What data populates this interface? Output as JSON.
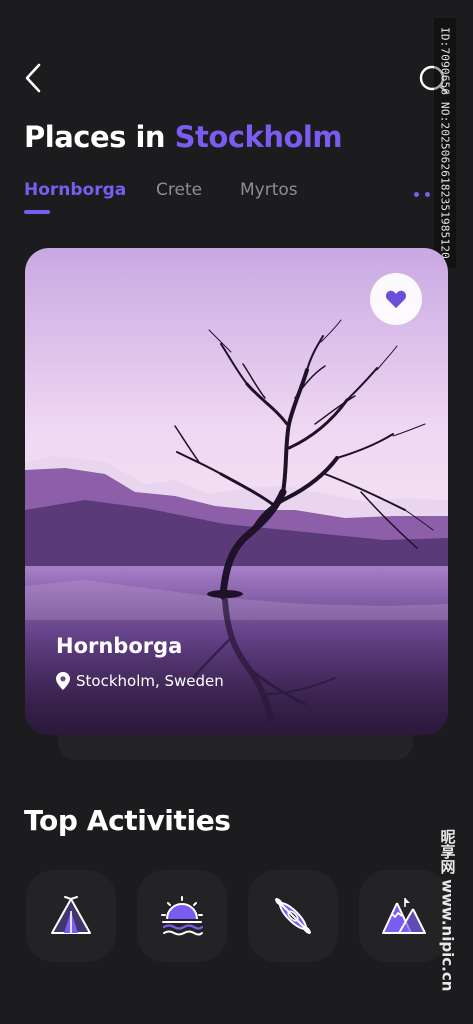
{
  "header": {
    "title_prefix": "Places in ",
    "title_city": "Stockholm"
  },
  "tabs": [
    {
      "label": "Hornborga",
      "active": true
    },
    {
      "label": "Crete",
      "active": false
    },
    {
      "label": "Myrtos",
      "active": false
    }
  ],
  "featured": {
    "name": "Hornborga",
    "location": "Stockholm, Sweden",
    "favorited": true
  },
  "activities": {
    "title": "Top Activities",
    "items": [
      {
        "icon": "tent-icon"
      },
      {
        "icon": "sunset-icon"
      },
      {
        "icon": "kayak-icon"
      },
      {
        "icon": "mountain-icon"
      }
    ]
  },
  "watermark": {
    "id_text": "ID:7090656 NO:20250626182351985120",
    "site_text": "昵享网 www.nipic.cn"
  },
  "colors": {
    "background": "#1c1c1e",
    "accent": "#7a5cf0",
    "muted_text": "#8d8d92",
    "tile": "#232325"
  }
}
